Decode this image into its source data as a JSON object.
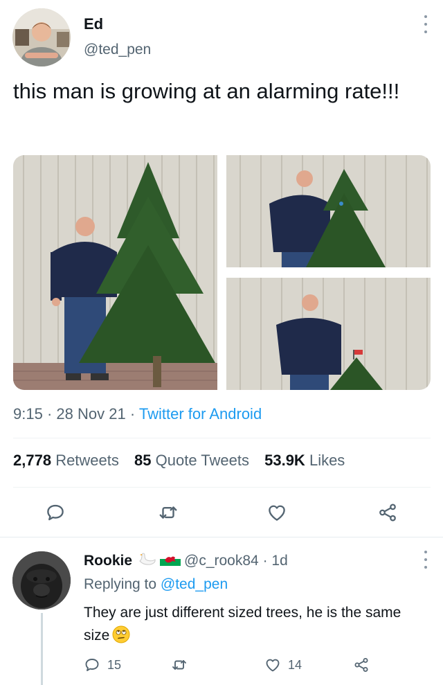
{
  "tweet": {
    "author_name": "Ed",
    "author_handle": "@ted_pen",
    "text": "this man is growing at an alarming rate!!!",
    "time": "9:15",
    "separator": "·",
    "date": "28 Nov 21",
    "source": "Twitter for Android",
    "stats": {
      "retweets_count": "2,778",
      "retweets_label": "Retweets",
      "quotes_count": "85",
      "quotes_label": "Quote Tweets",
      "likes_count": "53.9K",
      "likes_label": "Likes"
    },
    "icons": [
      "reply-icon",
      "retweet-icon",
      "like-icon",
      "share-icon"
    ]
  },
  "reply": {
    "author_name": "Rookie",
    "author_handle": "@c_rook84",
    "separator": "·",
    "age": "1d",
    "replying_prefix": "Replying to",
    "replying_to": "@ted_pen",
    "text": "They are just different sized trees, he is the same size",
    "reply_count": "15",
    "like_count": "14"
  },
  "colors": {
    "accent": "#1d9bf0",
    "secondary_text": "#536471",
    "primary_text": "#0f1419"
  }
}
